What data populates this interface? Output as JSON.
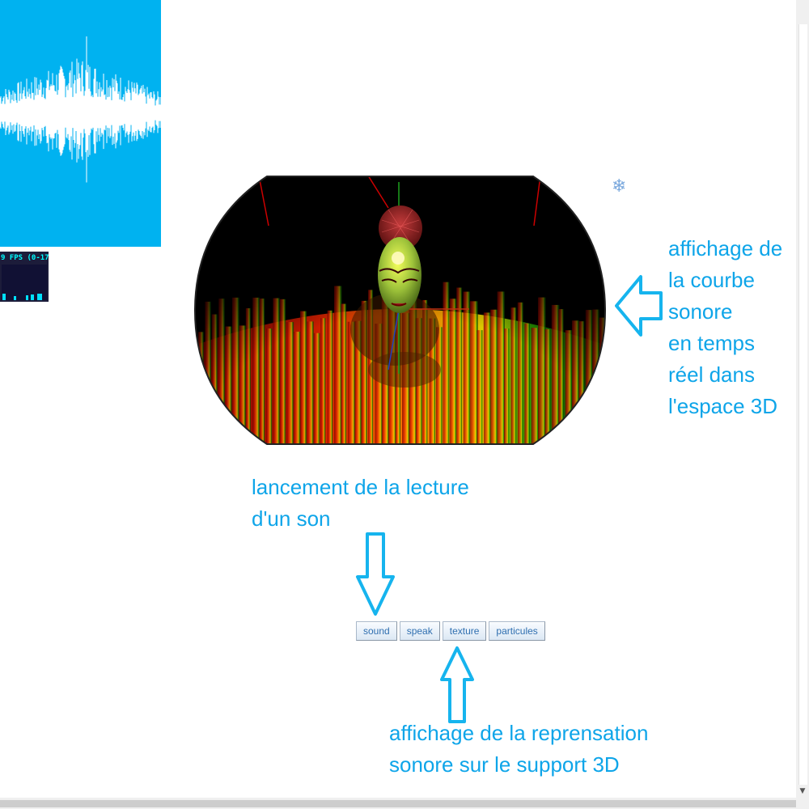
{
  "stats": {
    "fps_label": "9 FPS (0-17)"
  },
  "annotations": {
    "realtime_curve": "affichage de\nla courbe\nsonore\nen temps\nréel dans\nl'espace 3D",
    "play_sound": "lancement de la lecture\nd'un son",
    "support_representation": "affichage de la reprensation\nsonore sur le support 3D"
  },
  "buttons": [
    "sound",
    "speak",
    "texture",
    "particules"
  ],
  "colors": {
    "waveform_bg": "#00b2f0",
    "annotation": "#0ea5e9",
    "button_text": "#2f6fb0"
  },
  "icons": {
    "snowflake": "❄"
  }
}
